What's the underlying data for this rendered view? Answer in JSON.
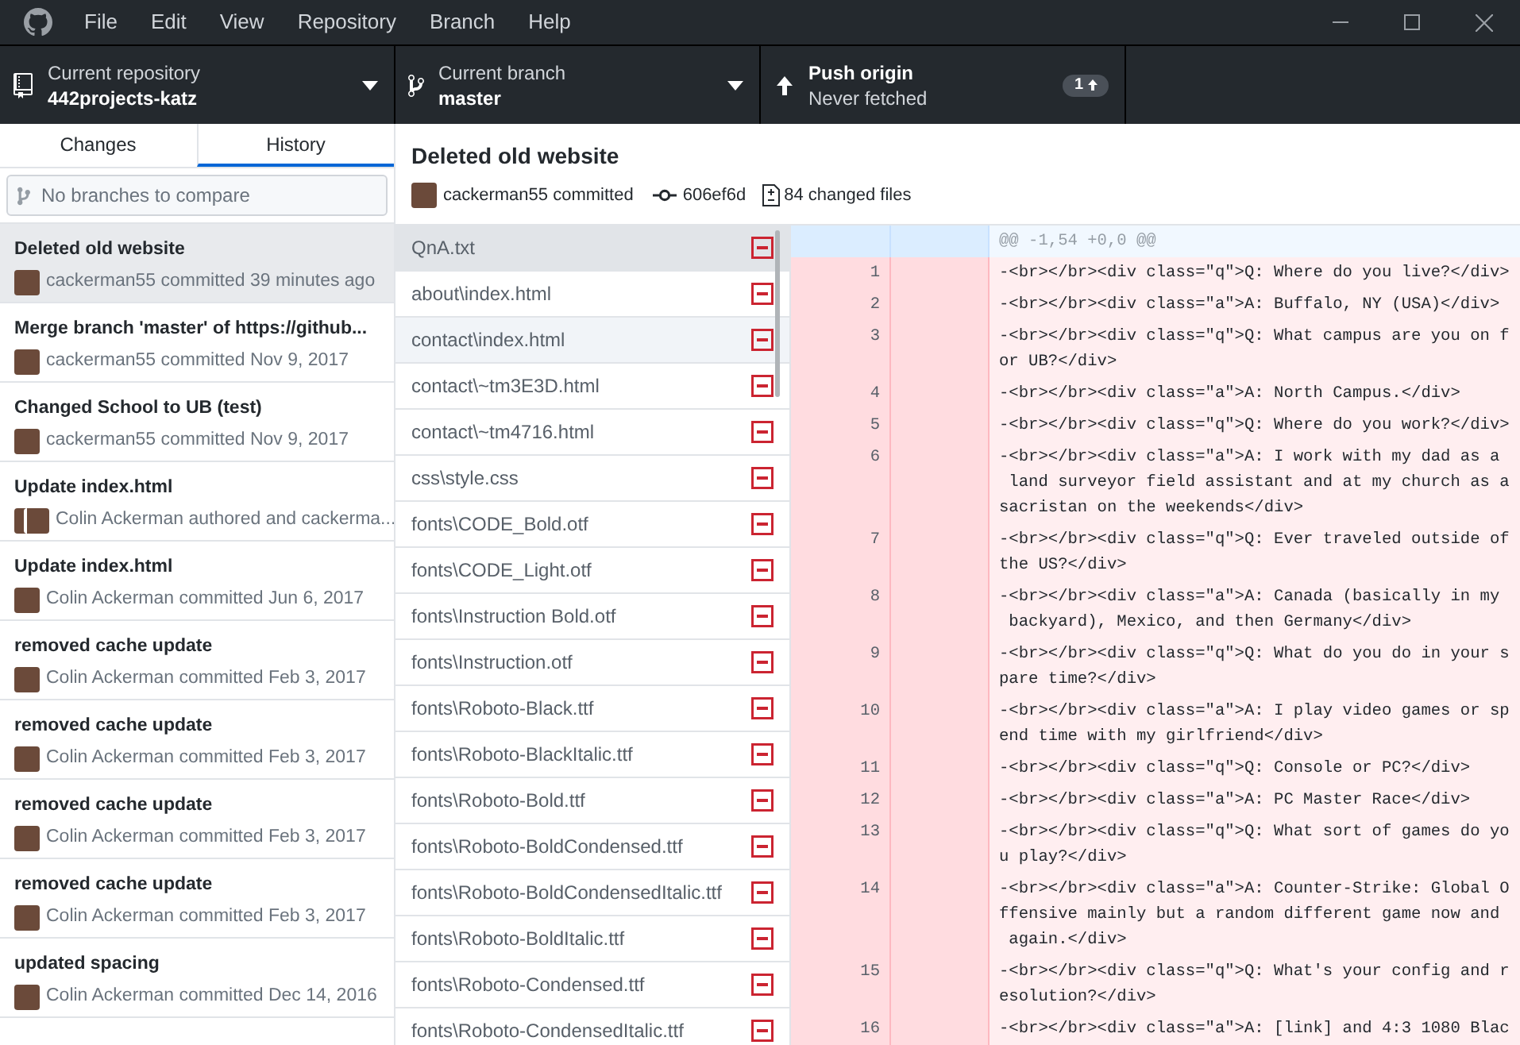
{
  "menu": [
    "File",
    "Edit",
    "View",
    "Repository",
    "Branch",
    "Help"
  ],
  "toolbar": {
    "repository": {
      "label": "Current repository",
      "value": "442projects-katz"
    },
    "branch": {
      "label": "Current branch",
      "value": "master"
    },
    "push": {
      "label": "Push origin",
      "sub": "Never fetched",
      "badge": "1"
    }
  },
  "tabs": [
    {
      "label": "Changes",
      "selected": false
    },
    {
      "label": "History",
      "selected": true
    }
  ],
  "compare": {
    "placeholder": "No branches to compare"
  },
  "commits": [
    {
      "title": "Deleted old website",
      "meta": "cackerman55 committed 39 minutes ago",
      "kind": "single",
      "selected": true
    },
    {
      "title": "Merge branch 'master' of https://github...",
      "meta": "cackerman55 committed Nov 9, 2017",
      "kind": "single",
      "selected": false
    },
    {
      "title": "Changed School to UB (test)",
      "meta": "cackerman55 committed Nov 9, 2017",
      "kind": "single",
      "selected": false
    },
    {
      "title": "Update index.html",
      "meta": "Colin Ackerman authored and cackerma...",
      "kind": "pair",
      "selected": false
    },
    {
      "title": "Update index.html",
      "meta": "Colin Ackerman committed Jun 6, 2017",
      "kind": "single",
      "selected": false
    },
    {
      "title": "removed cache update",
      "meta": "Colin Ackerman committed Feb 3, 2017",
      "kind": "single",
      "selected": false
    },
    {
      "title": "removed cache update",
      "meta": "Colin Ackerman committed Feb 3, 2017",
      "kind": "single",
      "selected": false
    },
    {
      "title": "removed cache update",
      "meta": "Colin Ackerman committed Feb 3, 2017",
      "kind": "single",
      "selected": false
    },
    {
      "title": "removed cache update",
      "meta": "Colin Ackerman committed Feb 3, 2017",
      "kind": "single",
      "selected": false
    },
    {
      "title": "updated spacing",
      "meta": "Colin Ackerman committed Dec 14, 2016",
      "kind": "single",
      "selected": false
    }
  ],
  "commit_header": {
    "title": "Deleted old website",
    "author": "cackerman55 committed",
    "sha": "606ef6d",
    "files": "84 changed files"
  },
  "files": [
    {
      "path": "QnA.txt",
      "kind": "deleted",
      "selected": true,
      "hovered": false
    },
    {
      "path": "about\\index.html",
      "kind": "deleted",
      "selected": false,
      "hovered": false
    },
    {
      "path": "contact\\index.html",
      "kind": "deleted",
      "selected": false,
      "hovered": true
    },
    {
      "path": "contact\\~tm3E3D.html",
      "kind": "deleted",
      "selected": false,
      "hovered": false
    },
    {
      "path": "contact\\~tm4716.html",
      "kind": "deleted",
      "selected": false,
      "hovered": false
    },
    {
      "path": "css\\style.css",
      "kind": "deleted",
      "selected": false,
      "hovered": false
    },
    {
      "path": "fonts\\CODE_Bold.otf",
      "kind": "deleted",
      "selected": false,
      "hovered": false
    },
    {
      "path": "fonts\\CODE_Light.otf",
      "kind": "deleted",
      "selected": false,
      "hovered": false
    },
    {
      "path": "fonts\\Instruction Bold.otf",
      "kind": "deleted",
      "selected": false,
      "hovered": false
    },
    {
      "path": "fonts\\Instruction.otf",
      "kind": "deleted",
      "selected": false,
      "hovered": false
    },
    {
      "path": "fonts\\Roboto-Black.ttf",
      "kind": "deleted",
      "selected": false,
      "hovered": false
    },
    {
      "path": "fonts\\Roboto-BlackItalic.ttf",
      "kind": "deleted",
      "selected": false,
      "hovered": false
    },
    {
      "path": "fonts\\Roboto-Bold.ttf",
      "kind": "deleted",
      "selected": false,
      "hovered": false
    },
    {
      "path": "fonts\\Roboto-BoldCondensed.ttf",
      "kind": "deleted",
      "selected": false,
      "hovered": false
    },
    {
      "path": "fonts\\Roboto-BoldCondensedItalic.ttf",
      "kind": "deleted",
      "selected": false,
      "hovered": false
    },
    {
      "path": "fonts\\Roboto-BoldItalic.ttf",
      "kind": "deleted",
      "selected": false,
      "hovered": false
    },
    {
      "path": "fonts\\Roboto-Condensed.ttf",
      "kind": "deleted",
      "selected": false,
      "hovered": false
    },
    {
      "path": "fonts\\Roboto-CondensedItalic.ttf",
      "kind": "deleted",
      "selected": false,
      "hovered": false
    }
  ],
  "diff": {
    "hunk": "@@ -1,54 +0,0 @@",
    "lines": [
      {
        "number": "1",
        "kind": "deleted",
        "text": [
          "-<br></br><div class=\"q\">Q: Where do you live?</div>"
        ]
      },
      {
        "number": "2",
        "kind": "deleted",
        "text": [
          "-<br></br><div class=\"a\">A: Buffalo, NY (USA)</div>"
        ]
      },
      {
        "number": "3",
        "kind": "deleted",
        "text": [
          "-<br></br><div class=\"q\">Q: What campus are you on f",
          "or UB?</div>"
        ]
      },
      {
        "number": "4",
        "kind": "deleted",
        "text": [
          "-<br></br><div class=\"a\">A: North Campus.</div>"
        ]
      },
      {
        "number": "5",
        "kind": "deleted",
        "text": [
          "-<br></br><div class=\"q\">Q: Where do you work?</div>"
        ]
      },
      {
        "number": "6",
        "kind": "deleted",
        "text": [
          "-<br></br><div class=\"a\">A: I work with my dad as a",
          " land surveyor field assistant and at my church as a",
          "sacristan on the weekends</div>"
        ]
      },
      {
        "number": "7",
        "kind": "deleted",
        "text": [
          "-<br></br><div class=\"q\">Q: Ever traveled outside of",
          "the US?</div>"
        ]
      },
      {
        "number": "8",
        "kind": "deleted",
        "text": [
          "-<br></br><div class=\"a\">A: Canada (basically in my",
          " backyard), Mexico, and then Germany</div>"
        ]
      },
      {
        "number": "9",
        "kind": "deleted",
        "text": [
          "-<br></br><div class=\"q\">Q: What do you do in your s",
          "pare time?</div>"
        ]
      },
      {
        "number": "10",
        "kind": "deleted",
        "text": [
          "-<br></br><div class=\"a\">A: I play video games or sp",
          "end time with my girlfriend</div>"
        ]
      },
      {
        "number": "11",
        "kind": "deleted",
        "text": [
          "-<br></br><div class=\"q\">Q: Console or PC?</div>"
        ]
      },
      {
        "number": "12",
        "kind": "deleted",
        "text": [
          "-<br></br><div class=\"a\">A: PC Master Race</div>"
        ]
      },
      {
        "number": "13",
        "kind": "deleted",
        "text": [
          "-<br></br><div class=\"q\">Q: What sort of games do yo",
          "u play?</div>"
        ]
      },
      {
        "number": "14",
        "kind": "deleted",
        "text": [
          "-<br></br><div class=\"a\">A: Counter-Strike: Global O",
          "ffensive mainly but a random different game now and",
          " again.</div>"
        ]
      },
      {
        "number": "15",
        "kind": "deleted",
        "text": [
          "-<br></br><div class=\"q\">Q: What's your config and r",
          "esolution?</div>"
        ]
      },
      {
        "number": "16",
        "kind": "deleted",
        "text": [
          "-<br></br><div class=\"a\">A: [link] and 4:3 1080 Blac"
        ]
      }
    ]
  }
}
